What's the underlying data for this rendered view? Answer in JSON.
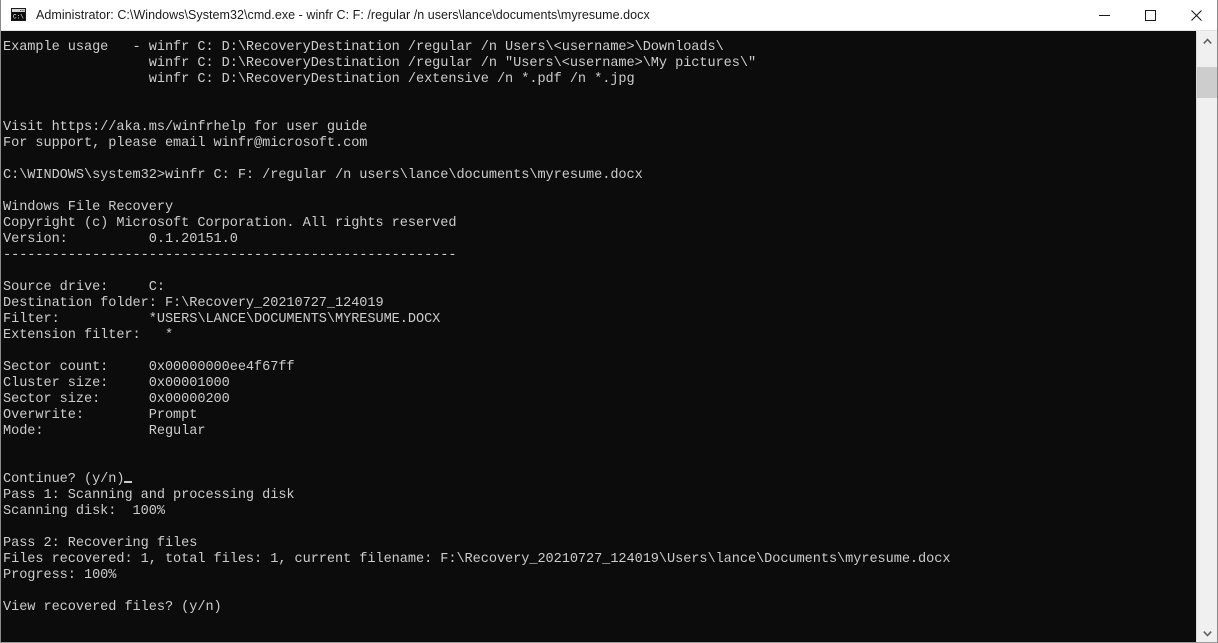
{
  "window": {
    "title": "Administrator: C:\\Windows\\System32\\cmd.exe - winfr  C: F: /regular /n users\\lance\\documents\\myresume.docx",
    "icon": "cmd-console-icon",
    "background_color": "#0c0c0c",
    "text_color": "#cccccc",
    "titlebar_color": "#ffffff",
    "controls": {
      "minimize_label": "—",
      "maximize_label": "□",
      "close_label": "✕"
    }
  },
  "scrollbar": {
    "up_arrow": "∧",
    "down_arrow": "∨",
    "thumb_position_percent": 3
  },
  "console": {
    "lines": [
      "Example usage   - winfr C: D:\\RecoveryDestination /regular /n Users\\<username>\\Downloads\\",
      "                  winfr C: D:\\RecoveryDestination /regular /n \"Users\\<username>\\My pictures\\\"",
      "                  winfr C: D:\\RecoveryDestination /extensive /n *.pdf /n *.jpg",
      "",
      "",
      "Visit https://aka.ms/winfrhelp for user guide",
      "For support, please email winfr@microsoft.com",
      "",
      "C:\\WINDOWS\\system32>winfr C: F: /regular /n users\\lance\\documents\\myresume.docx",
      "",
      "Windows File Recovery",
      "Copyright (c) Microsoft Corporation. All rights reserved",
      "Version:          0.1.20151.0",
      "--------------------------------------------------------",
      "",
      "Source drive:     C:",
      "Destination folder: F:\\Recovery_20210727_124019",
      "Filter:           *USERS\\LANCE\\DOCUMENTS\\MYRESUME.DOCX",
      "Extension filter:   *",
      "",
      "Sector count:     0x00000000ee4f67ff",
      "Cluster size:     0x00001000",
      "Sector size:      0x00000200",
      "Overwrite:        Prompt",
      "Mode:             Regular",
      "",
      "",
      "Continue? (y/n)",
      "Pass 1: Scanning and processing disk",
      "Scanning disk:  100%",
      "",
      "Pass 2: Recovering files",
      "Files recovered: 1, total files: 1, current filename: F:\\Recovery_20210727_124019\\Users\\lance\\Documents\\myresume.docx",
      "Progress: 100%",
      "",
      "View recovered files? (y/n)"
    ],
    "cursor_line_index": 27
  }
}
